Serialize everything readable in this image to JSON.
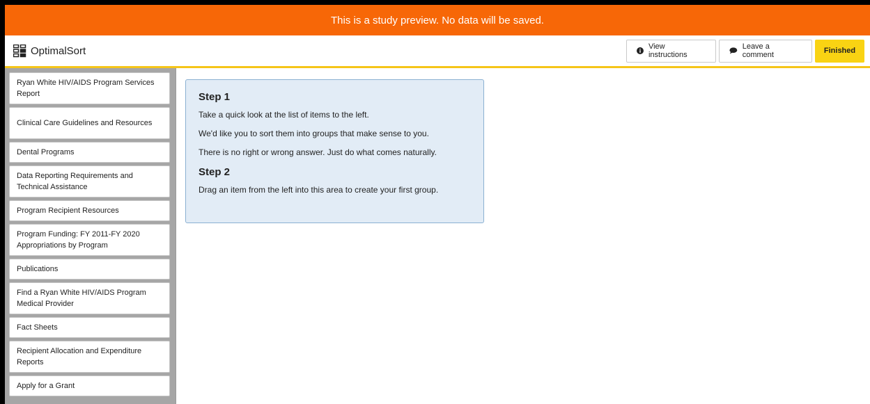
{
  "banner": {
    "text": "This is a study preview. No data will be saved."
  },
  "header": {
    "app_name": "OptimalSort",
    "view_instructions": "View instructions",
    "leave_comment": "Leave a comment",
    "finished": "Finished"
  },
  "cards": [
    {
      "label": "Ryan White HIV/AIDS Program Services Report"
    },
    {
      "label": "Clinical Care Guidelines and Resources"
    },
    {
      "label": "Dental Programs"
    },
    {
      "label": "Data Reporting Requirements and Technical Assistance"
    },
    {
      "label": "Program Recipient Resources"
    },
    {
      "label": "Program Funding: FY 2011-FY 2020 Appropriations by Program"
    },
    {
      "label": "Publications"
    },
    {
      "label": "Find a Ryan White HIV/AIDS Program Medical Provider"
    },
    {
      "label": "Fact Sheets"
    },
    {
      "label": "Recipient Allocation and Expenditure Reports"
    },
    {
      "label": "Apply for a Grant"
    }
  ],
  "instructions": {
    "step1_title": "Step 1",
    "step1_lines": [
      "Take a quick look at the list of items to the left.",
      "We'd like you to sort them into groups that make sense to you.",
      "There is no right or wrong answer. Just do what comes naturally."
    ],
    "step2_title": "Step 2",
    "step2_lines": [
      "Drag an item from the left into this area to create your first group."
    ]
  },
  "colors": {
    "banner": "#f76707",
    "accent": "#f9d313",
    "instructions_bg": "#e2ecf6"
  }
}
